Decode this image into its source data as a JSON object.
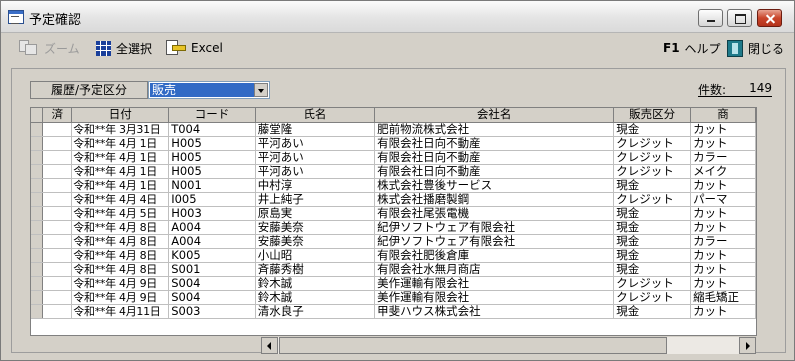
{
  "window": {
    "title": "予定確認"
  },
  "toolbar": {
    "zoom_label": "ズーム",
    "select_all_label": "全選択",
    "excel_label": "Excel",
    "help_key": "F1",
    "help_label": "ヘルプ",
    "close_label": "閉じる"
  },
  "filter": {
    "label": "履歴/予定区分",
    "selected": "販売"
  },
  "count": {
    "label": "件数:",
    "value": "149"
  },
  "table": {
    "columns": [
      "",
      "済",
      "日付",
      "コード",
      "氏名",
      "会社名",
      "販売区分",
      "商"
    ],
    "rows": [
      [
        "令和**年 3月31日",
        "T004",
        "藤堂隆",
        "肥前物流株式会社",
        "現金",
        "カット"
      ],
      [
        "令和**年 4月 1日",
        "H005",
        "平河あい",
        "有限会社日向不動産",
        "クレジット",
        "カット"
      ],
      [
        "令和**年 4月 1日",
        "H005",
        "平河あい",
        "有限会社日向不動産",
        "クレジット",
        "カラー"
      ],
      [
        "令和**年 4月 1日",
        "H005",
        "平河あい",
        "有限会社日向不動産",
        "クレジット",
        "メイク"
      ],
      [
        "令和**年 4月 1日",
        "N001",
        "中村淳",
        "株式会社豊後サービス",
        "現金",
        "カット"
      ],
      [
        "令和**年 4月 4日",
        "I005",
        "井上純子",
        "株式会社播磨製鋼",
        "クレジット",
        "パーマ"
      ],
      [
        "令和**年 4月 5日",
        "H003",
        "原島実",
        "有限会社尾張電機",
        "現金",
        "カット"
      ],
      [
        "令和**年 4月 8日",
        "A004",
        "安藤美奈",
        "紀伊ソフトウェア有限会社",
        "現金",
        "カット"
      ],
      [
        "令和**年 4月 8日",
        "A004",
        "安藤美奈",
        "紀伊ソフトウェア有限会社",
        "現金",
        "カラー"
      ],
      [
        "令和**年 4月 8日",
        "K005",
        "小山昭",
        "有限会社肥後倉庫",
        "現金",
        "カット"
      ],
      [
        "令和**年 4月 8日",
        "S001",
        "斉藤秀樹",
        "有限会社水無月商店",
        "現金",
        "カット"
      ],
      [
        "令和**年 4月 9日",
        "S004",
        "鈴木誠",
        "美作運輸有限会社",
        "クレジット",
        "カット"
      ],
      [
        "令和**年 4月 9日",
        "S004",
        "鈴木誠",
        "美作運輸有限会社",
        "クレジット",
        "縮毛矯正"
      ],
      [
        "令和**年 4月11日",
        "S003",
        "清水良子",
        "甲斐ハウス株式会社",
        "現金",
        "カット"
      ]
    ]
  }
}
